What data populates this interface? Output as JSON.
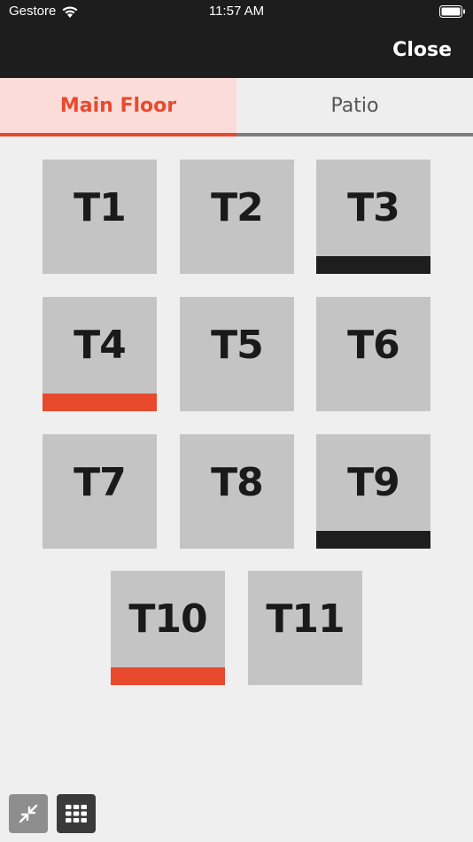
{
  "status_bar": {
    "carrier": "Gestore",
    "time": "11:57 AM",
    "wifi_icon": "wifi-icon",
    "battery_icon": "battery-icon"
  },
  "header": {
    "close_label": "Close"
  },
  "tabs": [
    {
      "label": "Main Floor",
      "active": true
    },
    {
      "label": "Patio",
      "active": false
    }
  ],
  "colors": {
    "accent": "#e84a2e",
    "occupied_dark": "#1e1e1e",
    "tile": "#c4c4c4",
    "header_bg": "#1d1d1d"
  },
  "tables": [
    {
      "label": "T1",
      "status": "free"
    },
    {
      "label": "T2",
      "status": "free"
    },
    {
      "label": "T3",
      "status": "dark"
    },
    {
      "label": "T4",
      "status": "red"
    },
    {
      "label": "T5",
      "status": "free"
    },
    {
      "label": "T6",
      "status": "free"
    },
    {
      "label": "T7",
      "status": "free"
    },
    {
      "label": "T8",
      "status": "free"
    },
    {
      "label": "T9",
      "status": "dark"
    },
    {
      "label": "T10",
      "status": "red"
    },
    {
      "label": "T11",
      "status": "free"
    }
  ],
  "toolbar": {
    "collapse_icon": "collapse-arrows-icon",
    "grid_icon": "grid-icon"
  }
}
